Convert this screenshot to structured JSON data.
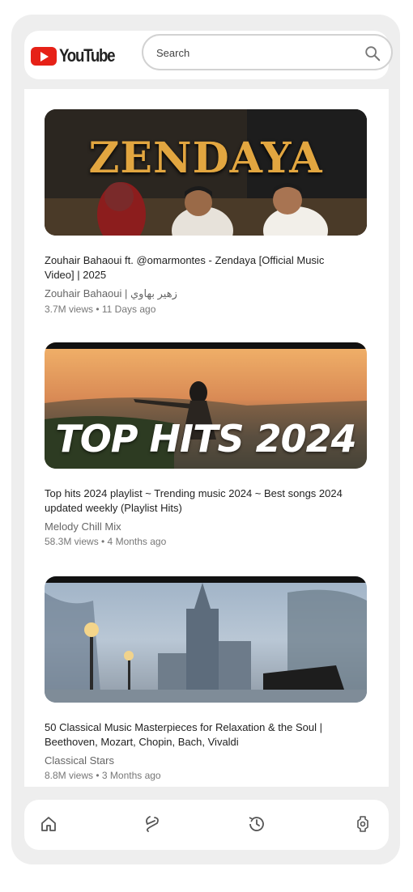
{
  "header": {
    "logo_text": "YouTube",
    "search_placeholder": "Search"
  },
  "videos": [
    {
      "thumbnail_text": "ZENDAYA",
      "title": "Zouhair Bahaoui ft. @omarmontes - Zendaya [Official Music Video] | 2025",
      "channel": "Zouhair Bahaoui | زهير بهاوي",
      "meta": "3.7M views • 11 Days ago"
    },
    {
      "thumbnail_text": "TOP HITS 2024",
      "title": "Top hits 2024 playlist ~ Trending music 2024 ~ Best songs 2024 updated weekly (Playlist Hits)",
      "channel": "Melody Chill Mix",
      "meta": "58.3M views • 4 Months ago"
    },
    {
      "thumbnail_text": "",
      "title": "50 Classical Music Masterpieces for Relaxation & the Soul | Beethoven, Mozart, Chopin, Bach, Vivaldi",
      "channel": "Classical Stars",
      "meta": "8.8M views • 3 Months ago"
    }
  ],
  "bottom_nav": {
    "items": [
      "home-icon",
      "shorts-icon",
      "history-icon",
      "settings-icon"
    ]
  },
  "colors": {
    "brand_red": "#e62117",
    "background": "#eeeeee"
  }
}
